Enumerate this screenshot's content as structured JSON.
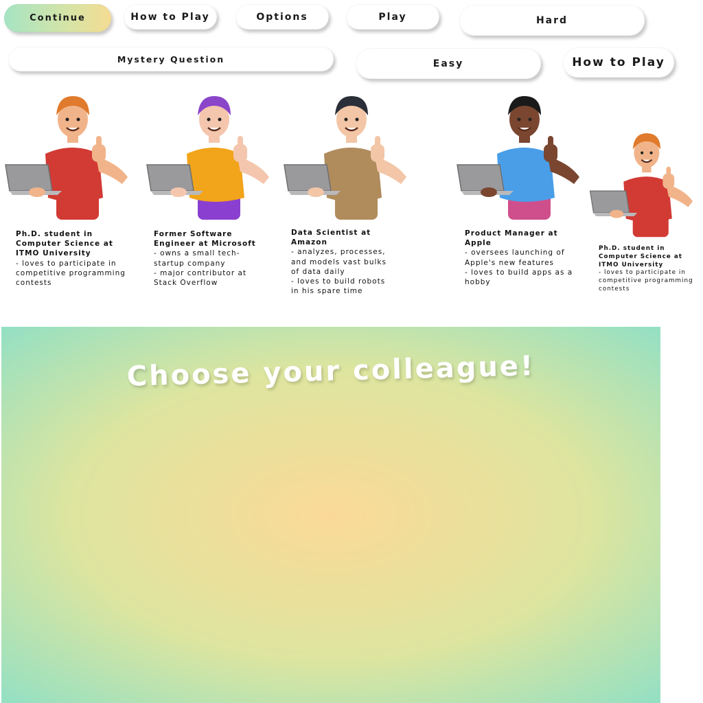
{
  "buttons": {
    "continue": "Continue",
    "how_to_play_1": "How to Play",
    "options": "Options",
    "play": "Play",
    "hard": "Hard",
    "mystery_question": "Mystery Question",
    "easy": "Easy",
    "how_to_play_2": "How to Play"
  },
  "characters": [
    {
      "title": "Ph.D. student in Computer Science at ITMO University",
      "bio": "- loves to participate in competitive programming contests",
      "shirt": "#d23a34",
      "skin": "#f1b48a",
      "hair": "#e07a2c",
      "legs": "#d23a34"
    },
    {
      "title": "Former Software Engineer at Microsoft",
      "bio": "- owns a small tech-startup company\n- major contributor at Stack Overflow",
      "shirt": "#f2a41a",
      "skin": "#f4c6ae",
      "hair": "#8a45c9",
      "legs": "#8a3fd0"
    },
    {
      "title": "Data Scientist at Amazon",
      "bio": "- analyzes, processes, and models vast bulks of data daily\n- loves to build robots in his spare time",
      "shirt": "#b08b5c",
      "skin": "#f2c6a6",
      "hair": "#2b2f3a",
      "legs": "#b08b5c"
    },
    {
      "title": "Product Manager at Apple",
      "bio": "- oversees launching of Apple's new features\n- loves to build apps as a hobby",
      "shirt": "#4a9ee8",
      "skin": "#7a4630",
      "hair": "#1a1a1a",
      "legs": "#cf4f8c"
    },
    {
      "title": "Ph.D. student in Computer Science at ITMO University",
      "bio": "- loves to participate in competitive programming contests",
      "shirt": "#d23a34",
      "skin": "#f1b48a",
      "hair": "#e07a2c",
      "legs": "#d23a34"
    }
  ],
  "panel": {
    "title": "Choose your colleague!"
  },
  "colors": {
    "gradient_center": "#fbd998",
    "gradient_edge": "#92e0c4",
    "button_bg": "#ffffff"
  }
}
